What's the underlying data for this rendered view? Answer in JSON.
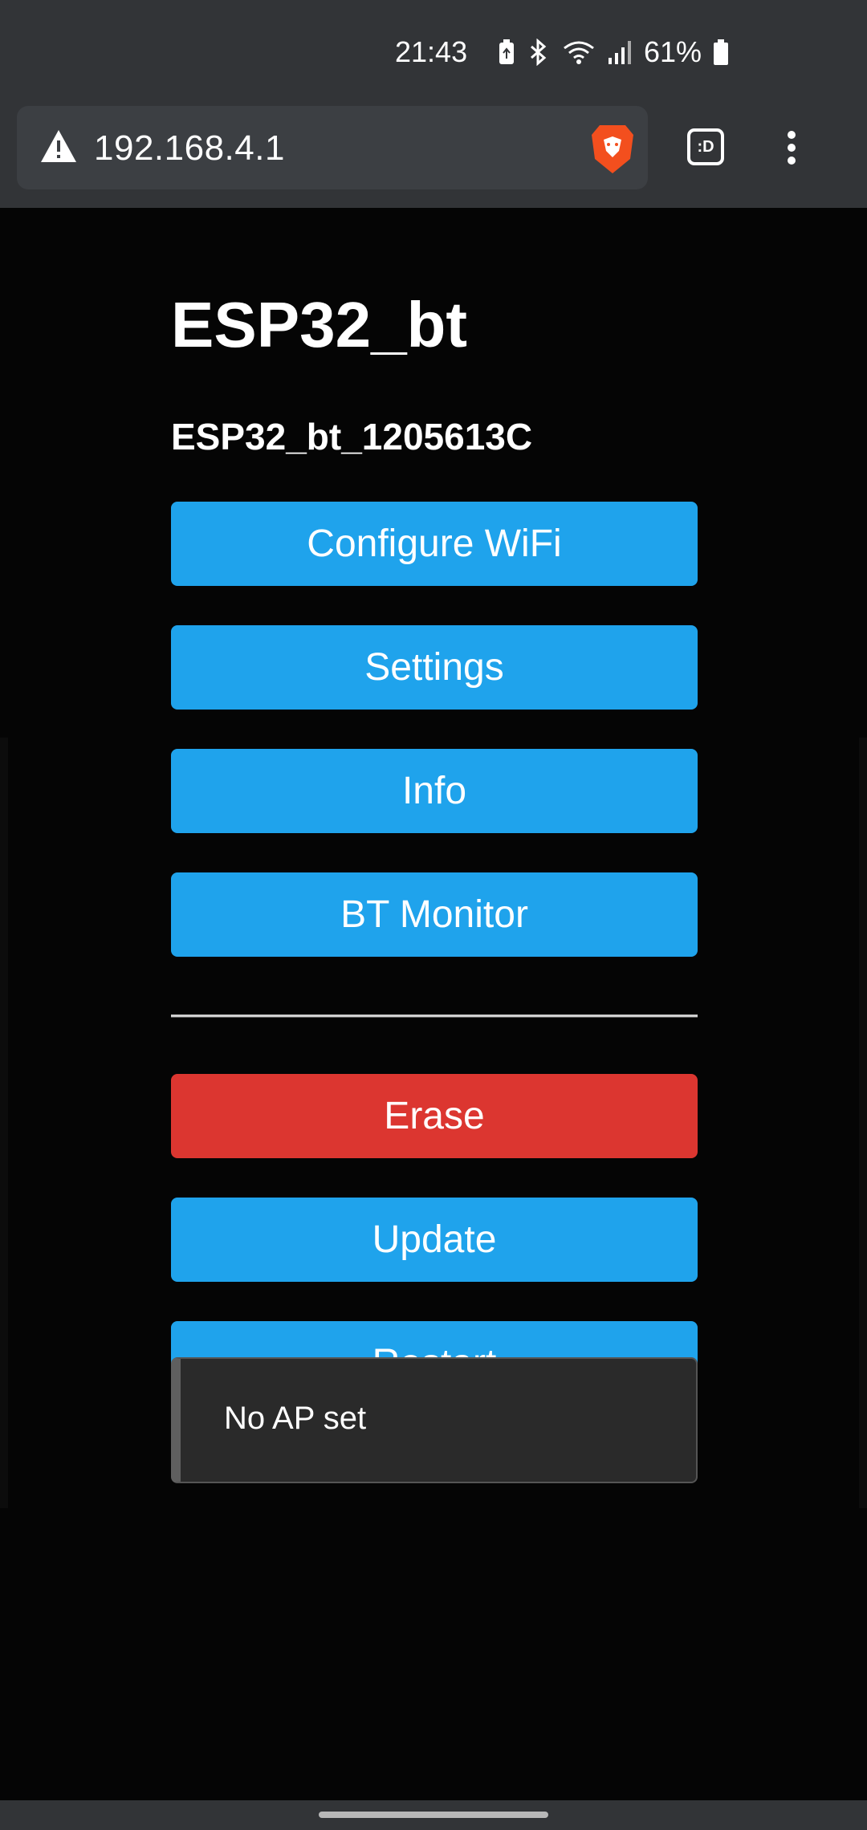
{
  "status_bar": {
    "time": "21:43",
    "battery_percent": "61%",
    "icons": [
      "battery-saver-icon",
      "bluetooth-icon",
      "wifi-icon",
      "signal-icon",
      "battery-icon"
    ]
  },
  "browser": {
    "url": "192.168.4.1",
    "tabs_label": ":D",
    "icons": [
      "warning-icon",
      "brave-icon",
      "tabs-icon",
      "more-vert-icon"
    ]
  },
  "page": {
    "title": "ESP32_bt",
    "device_id": "ESP32_bt_1205613C",
    "buttons_primary": [
      {
        "label": "Configure WiFi"
      },
      {
        "label": "Settings"
      },
      {
        "label": "Info"
      },
      {
        "label": "BT Monitor"
      }
    ],
    "buttons_secondary": [
      {
        "label": "Erase",
        "color": "#dc3630"
      },
      {
        "label": "Update"
      },
      {
        "label": "Restart"
      }
    ],
    "status_message": "No AP set"
  },
  "colors": {
    "button_blue": "#1fa3ec",
    "button_red": "#dc3630",
    "background": "#050505",
    "chrome": "#323437"
  }
}
